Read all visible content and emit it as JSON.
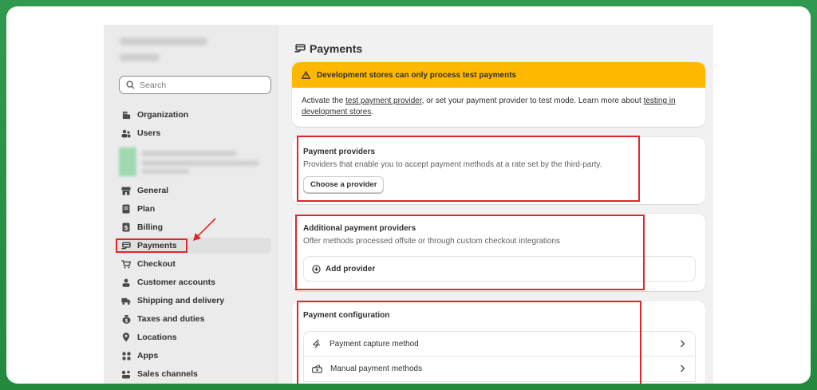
{
  "sidebar": {
    "search_placeholder": "Search",
    "items": [
      {
        "label": "Organization",
        "icon": "organization-icon"
      },
      {
        "label": "Users",
        "icon": "users-icon"
      },
      {
        "label": "General",
        "icon": "store-icon"
      },
      {
        "label": "Plan",
        "icon": "plan-icon"
      },
      {
        "label": "Billing",
        "icon": "billing-icon"
      },
      {
        "label": "Payments",
        "icon": "payments-icon"
      },
      {
        "label": "Checkout",
        "icon": "cart-icon"
      },
      {
        "label": "Customer accounts",
        "icon": "person-icon"
      },
      {
        "label": "Shipping and delivery",
        "icon": "truck-icon"
      },
      {
        "label": "Taxes and duties",
        "icon": "tax-icon"
      },
      {
        "label": "Locations",
        "icon": "location-icon"
      },
      {
        "label": "Apps",
        "icon": "apps-icon"
      },
      {
        "label": "Sales channels",
        "icon": "sales-channels-icon"
      }
    ]
  },
  "main": {
    "title": "Payments",
    "banner": {
      "heading": "Development stores can only process test payments",
      "text_1": "Activate the ",
      "link_1": "test payment provider",
      "text_2": ", or set your payment provider to test mode. Learn more about ",
      "link_2": "testing in development stores",
      "text_3": "."
    },
    "providers": {
      "title": "Payment providers",
      "subtitle": "Providers that enable you to accept payment methods at a rate set by the third-party.",
      "button": "Choose a provider"
    },
    "additional": {
      "title": "Additional payment providers",
      "subtitle": "Offer methods processed offsite or through custom checkout integrations",
      "button": "Add provider"
    },
    "configuration": {
      "title": "Payment configuration",
      "rows": [
        {
          "label": "Payment capture method"
        },
        {
          "label": "Manual payment methods"
        }
      ]
    }
  },
  "colors": {
    "banner": "#ffb800",
    "highlight": "#e0262b",
    "background": "#2f9a4f"
  }
}
